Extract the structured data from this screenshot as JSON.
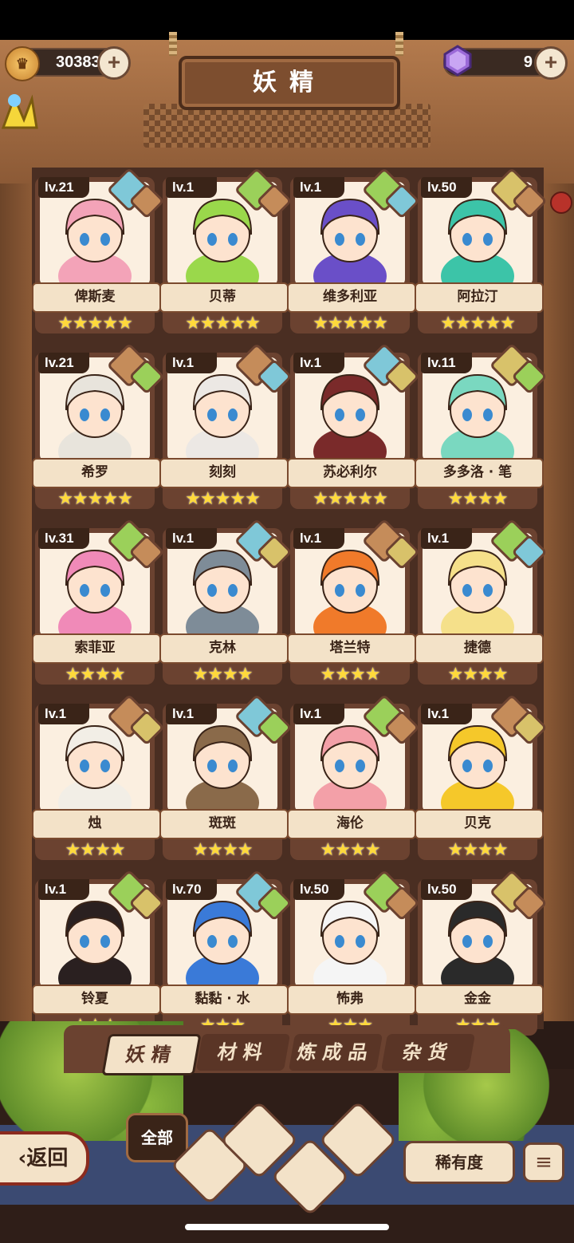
{
  "header": {
    "title": "妖精",
    "coins": "30383",
    "gems": "9",
    "plus": "+"
  },
  "cards": [
    {
      "level": "lv.21",
      "name": "俾斯麦",
      "stars": "★★★★★",
      "hair": "#f3a3b8",
      "e1": "#7fc8d8",
      "e2": "#c58c5a"
    },
    {
      "level": "lv.1",
      "name": "贝蒂",
      "stars": "★★★★★",
      "hair": "#9ad84b",
      "e1": "#9bd05a",
      "e2": "#c58c5a"
    },
    {
      "level": "lv.1",
      "name": "维多利亚",
      "stars": "★★★★★",
      "hair": "#6a4fc8",
      "e1": "#9bd05a",
      "e2": "#7fc8d8"
    },
    {
      "level": "lv.50",
      "name": "阿拉汀",
      "stars": "★★★★★",
      "hair": "#3cc4a8",
      "e1": "#d8c26a",
      "e2": "#c58c5a"
    },
    {
      "level": "lv.21",
      "name": "希罗",
      "stars": "★★★★★",
      "hair": "#e8e4dc",
      "e1": "#c58c5a",
      "e2": "#9bd05a"
    },
    {
      "level": "lv.1",
      "name": "刻刻",
      "stars": "★★★★★",
      "hair": "#ece8e4",
      "e1": "#c58c5a",
      "e2": "#7fc8d8"
    },
    {
      "level": "lv.1",
      "name": "苏必利尔",
      "stars": "★★★★★",
      "hair": "#7a2a2a",
      "e1": "#7fc8d8",
      "e2": "#d8c26a"
    },
    {
      "level": "lv.11",
      "name": "多多洛 · 笔",
      "stars": "★★★★",
      "hair": "#7ad8c0",
      "e1": "#d8c26a",
      "e2": "#9bd05a"
    },
    {
      "level": "lv.31",
      "name": "索菲亚",
      "stars": "★★★★",
      "hair": "#f08ab8",
      "e1": "#9bd05a",
      "e2": "#c58c5a"
    },
    {
      "level": "lv.1",
      "name": "克林",
      "stars": "★★★★",
      "hair": "#7e8c98",
      "e1": "#7fc8d8",
      "e2": "#d8c26a"
    },
    {
      "level": "lv.1",
      "name": "塔兰特",
      "stars": "★★★★",
      "hair": "#f07a2a",
      "e1": "#c58c5a",
      "e2": "#d8c26a"
    },
    {
      "level": "lv.1",
      "name": "捷德",
      "stars": "★★★★",
      "hair": "#f5e08a",
      "e1": "#9bd05a",
      "e2": "#7fc8d8"
    },
    {
      "level": "lv.1",
      "name": "烛",
      "stars": "★★★★",
      "hair": "#f2eee6",
      "e1": "#c58c5a",
      "e2": "#d8c26a"
    },
    {
      "level": "lv.1",
      "name": "斑斑",
      "stars": "★★★★",
      "hair": "#8a6a4a",
      "e1": "#7fc8d8",
      "e2": "#9bd05a"
    },
    {
      "level": "lv.1",
      "name": "海伦",
      "stars": "★★★★",
      "hair": "#f3a0a8",
      "e1": "#9bd05a",
      "e2": "#c58c5a"
    },
    {
      "level": "lv.1",
      "name": "贝克",
      "stars": "★★★★",
      "hair": "#f5c82a",
      "e1": "#c58c5a",
      "e2": "#d8c26a"
    },
    {
      "level": "lv.1",
      "name": "铃夏",
      "stars": "★★★",
      "hair": "#2a2020",
      "e1": "#9bd05a",
      "e2": "#d8c26a"
    },
    {
      "level": "lv.70",
      "name": "黏黏 · 水",
      "stars": "★★★",
      "hair": "#3a7ad8",
      "e1": "#7fc8d8",
      "e2": "#9bd05a"
    },
    {
      "level": "lv.50",
      "name": "怖弗",
      "stars": "★★★",
      "hair": "#f5f5f5",
      "e1": "#9bd05a",
      "e2": "#c58c5a"
    },
    {
      "level": "lv.50",
      "name": "金金",
      "stars": "★★★",
      "hair": "#2a2a2a",
      "e1": "#d8c26a",
      "e2": "#c58c5a"
    }
  ],
  "tabs": [
    "妖精",
    "材料",
    "炼成品",
    "杂货"
  ],
  "bottom": {
    "back": "返回",
    "all": "全部",
    "rarity": "稀有度",
    "sort": "≡"
  }
}
